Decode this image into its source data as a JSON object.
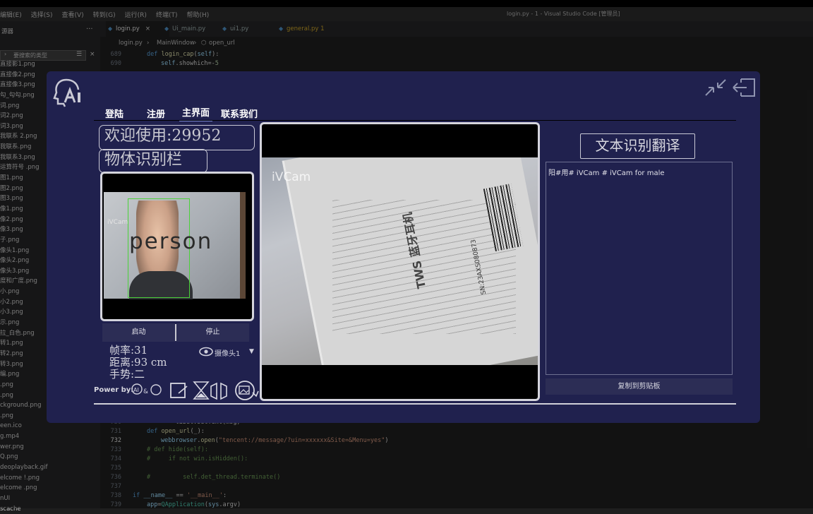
{
  "vscode": {
    "menu": [
      "编辑(E)",
      "选择(S)",
      "查看(V)",
      "转到(G)",
      "运行(R)",
      "终端(T)",
      "帮助(H)"
    ],
    "window_title": "login.py - 1 - Visual Studio Code [管理员]",
    "explorer_header": "源器",
    "search_placeholder": "要搜索的类型",
    "files": [
      "直接影1.png",
      "直接像2.png",
      "直接像3.png",
      "勾_勾勾.png",
      "词.png",
      "词2.png",
      "词3.png",
      "我联系 2.png",
      "我联系.png",
      "我联系3.png",
      "运算符号 .png",
      "图1.png",
      "图2.png",
      "图3.png",
      "像1.png",
      "像2.png",
      "像3.png",
      "子.png",
      "像头1.png",
      "像头2.png",
      "像头3.png",
      "度和广度.png",
      "小.png",
      "小2.png",
      "小3.png",
      "示.png",
      "拉_白色.png",
      "转1.png",
      "转2.png",
      "转3.png",
      "编.png",
      ".png",
      ".png",
      "ckground.png",
      ".png",
      "een.ico",
      "g.mp4",
      "wer.png",
      "Q.png",
      "deoplayback.gif",
      "elcome !.png",
      "elcome .png",
      "nUI",
      "scache"
    ],
    "tabs": [
      {
        "label": "login.py",
        "close": "×"
      },
      {
        "label": "Ui_main.py"
      },
      {
        "label": "ui1.py"
      },
      {
        "label": "general.py 1"
      }
    ],
    "breadcrumb": {
      "file": "login.py",
      "class": "MainWindow",
      "method": "open_url"
    },
    "code_top": [
      {
        "ln": "689",
        "text": "def login_cap(self):"
      },
      {
        "ln": "690",
        "text": "    self.showhich=-5"
      }
    ],
    "code_bottom": [
      {
        "ln": "730",
        "text": "    label.setText(msg)"
      },
      {
        "ln": "731",
        "text": "def open_url(_):"
      },
      {
        "ln": "732",
        "text": "    webbrowser.open(\"tencent://message/?uin=xxxxxx&Site=&Menu=yes\")"
      },
      {
        "ln": "733",
        "text": "# def hide(self):"
      },
      {
        "ln": "734",
        "text": "#     if not win.isHidden():"
      },
      {
        "ln": "735",
        "text": ""
      },
      {
        "ln": "736",
        "text": "#         self.det_thread.terminate()"
      },
      {
        "ln": "737",
        "text": ""
      },
      {
        "ln": "738",
        "text": "if __name__ == '__main__':"
      },
      {
        "ln": "739",
        "text": "    app=QApplication(sys.argv)"
      }
    ]
  },
  "app": {
    "nav": [
      "登陆",
      "注册",
      "主界面",
      "联系我们"
    ],
    "welcome": "欢迎使用:29952",
    "object_title": "物体识别栏",
    "detection_label": "person",
    "camera_watermark": "iVCam",
    "start_label": "启动",
    "stop_label": "停止",
    "fps": "帧率:31",
    "distance": "距离:93 cm",
    "gesture": "手势:二",
    "camera_select": "摄像头1",
    "powered_by": "Power by:",
    "main_watermark": "iVCam",
    "box_brand": "TWS 蓝牙耳机",
    "box_sn": "SN:23AXS080873",
    "ocr_title": "文本识别翻译",
    "ocr_text": "阳#用# iVCam # iVCam for male",
    "copy_label": "复制到剪贴板"
  }
}
